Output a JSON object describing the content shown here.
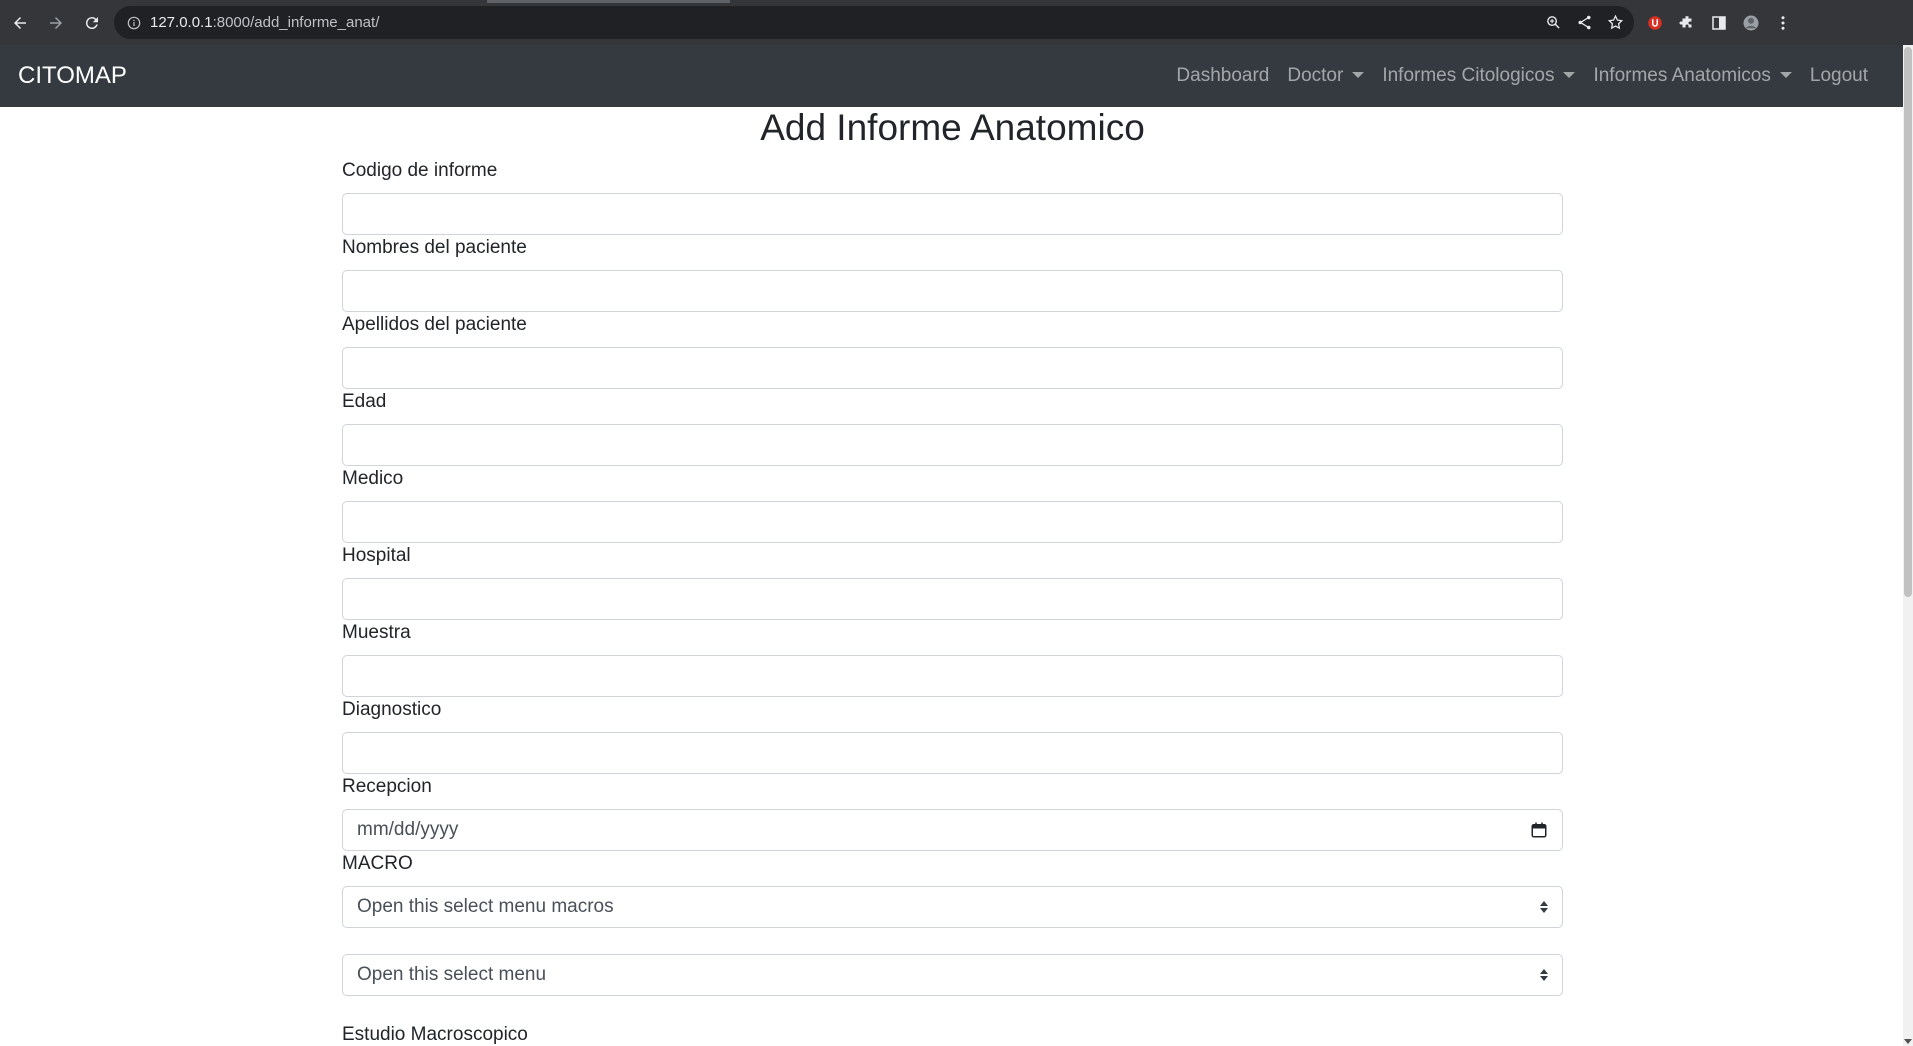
{
  "browser": {
    "url_host": "127.0.0.1",
    "url_rest": ":8000/add_informe_anat/"
  },
  "navbar": {
    "brand": "CITOMAP",
    "items": [
      {
        "label": "Dashboard",
        "dropdown": false
      },
      {
        "label": "Doctor",
        "dropdown": true
      },
      {
        "label": "Informes Citologicos",
        "dropdown": true
      },
      {
        "label": "Informes Anatomicos",
        "dropdown": true
      },
      {
        "label": "Logout",
        "dropdown": false
      }
    ]
  },
  "page": {
    "title": "Add Informe Anatomico"
  },
  "form": {
    "fields": [
      {
        "label": "Codigo de informe",
        "value": ""
      },
      {
        "label": "Nombres del paciente",
        "value": ""
      },
      {
        "label": "Apellidos del paciente",
        "value": ""
      },
      {
        "label": "Edad",
        "value": ""
      },
      {
        "label": "Medico",
        "value": ""
      },
      {
        "label": "Hospital",
        "value": ""
      },
      {
        "label": "Muestra",
        "value": ""
      },
      {
        "label": "Diagnostico",
        "value": ""
      }
    ],
    "recepcion": {
      "label": "Recepcion",
      "placeholder": "mm/dd/yyyy"
    },
    "macro": {
      "label": "MACRO",
      "selected": "Open this select menu macros"
    },
    "second_select": {
      "selected": "Open this select menu"
    },
    "estudio_label": "Estudio Macroscopico"
  },
  "colors": {
    "navbar_bg": "#343a40",
    "chrome_bg": "#35363a",
    "omnibox_bg": "#202124"
  }
}
